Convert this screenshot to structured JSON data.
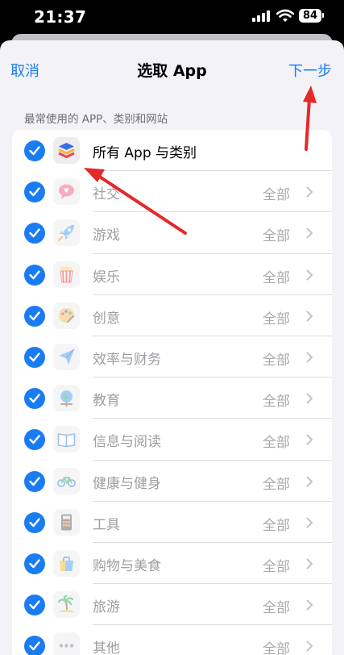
{
  "status": {
    "time": "21:37",
    "battery": "84"
  },
  "nav": {
    "cancel": "取消",
    "title": "选取 App",
    "next": "下一步"
  },
  "section": {
    "header": "最常使用的 APP、类别和网站"
  },
  "rows": [
    {
      "label": "所有 App 与类别",
      "value": "",
      "icon": "layers-icon"
    },
    {
      "label": "社交",
      "value": "全部",
      "icon": "chat-bubble-heart-icon"
    },
    {
      "label": "游戏",
      "value": "全部",
      "icon": "rocket-icon"
    },
    {
      "label": "娱乐",
      "value": "全部",
      "icon": "popcorn-icon"
    },
    {
      "label": "创意",
      "value": "全部",
      "icon": "palette-icon"
    },
    {
      "label": "效率与财务",
      "value": "全部",
      "icon": "paper-plane-icon"
    },
    {
      "label": "教育",
      "value": "全部",
      "icon": "globe-icon"
    },
    {
      "label": "信息与阅读",
      "value": "全部",
      "icon": "book-icon"
    },
    {
      "label": "健康与健身",
      "value": "全部",
      "icon": "bicycle-icon"
    },
    {
      "label": "工具",
      "value": "全部",
      "icon": "calculator-icon"
    },
    {
      "label": "购物与美食",
      "value": "全部",
      "icon": "shopping-bag-icon"
    },
    {
      "label": "旅游",
      "value": "全部",
      "icon": "palm-tree-icon"
    },
    {
      "label": "其他",
      "value": "全部",
      "icon": "more-dots-icon"
    }
  ],
  "colors": {
    "accent": "#1a7cf2",
    "annotation": "#e5282a"
  }
}
